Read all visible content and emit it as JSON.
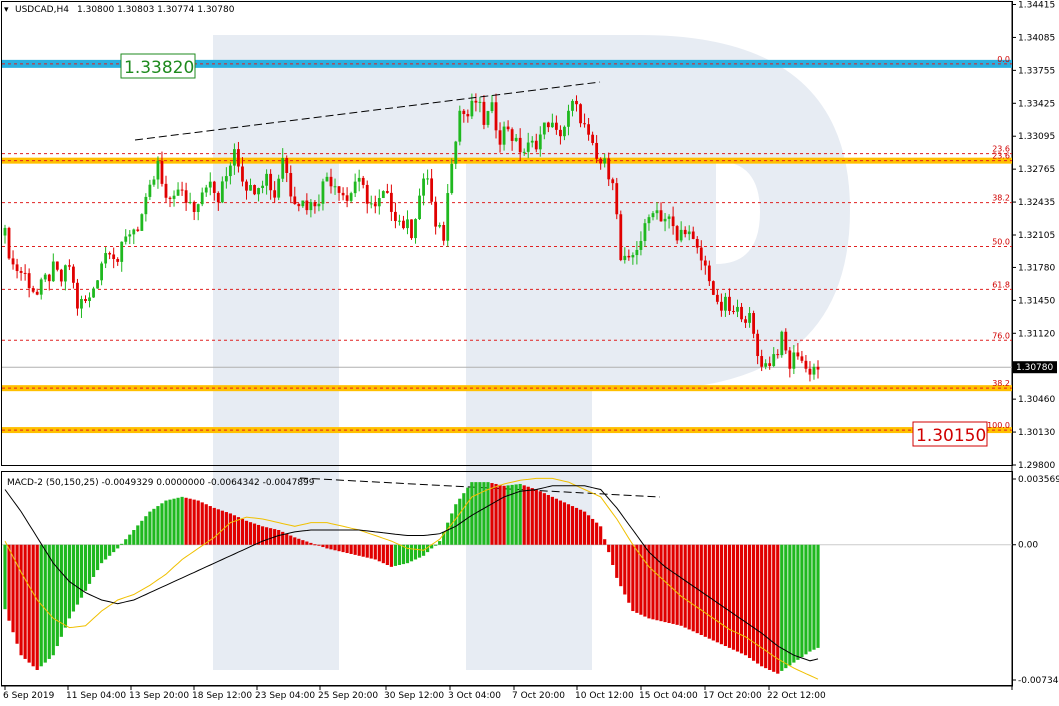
{
  "header": {
    "symbol": "USDCAD,H4",
    "ohlc": "1.30800 1.30803 1.30774 1.30780"
  },
  "macd_header": "MACD-2 (50,150,25) -0.0049329 0.0000000 -0.0064342 -0.0047899",
  "colors": {
    "bull": "#1fb81f",
    "bear": "#e00000",
    "resistance": "#2ab0e0",
    "support": "#ffc000",
    "fib": "#e02020",
    "macd_signal": "#f0c000",
    "macd_line": "#000000"
  },
  "chart_data": {
    "type": "candlestick",
    "symbol": "USDCAD",
    "timeframe": "H4",
    "ylim": [
      1.298,
      1.3441
    ],
    "price_ticks": [
      "1.34415",
      "1.34085",
      "1.33755",
      "1.33425",
      "1.33095",
      "1.32765",
      "1.32435",
      "1.32105",
      "1.31780",
      "1.31450",
      "1.31120",
      "1.30790",
      "1.30460",
      "1.30130",
      "1.29800"
    ],
    "current_price": "1.30780",
    "key_levels": [
      {
        "label": "1.33820",
        "value": 1.3382,
        "kind": "resistance"
      },
      {
        "label": "1.30150",
        "value": 1.3015,
        "kind": "support"
      }
    ],
    "support_zones": [
      1.3285,
      1.3057,
      1.3015
    ],
    "fib_levels": [
      {
        "label": "0.0",
        "value": 1.3382
      },
      {
        "label": "23.6",
        "value": 1.3292
      },
      {
        "label": "23.6",
        "value": 1.3285
      },
      {
        "label": "38.2",
        "value": 1.3243
      },
      {
        "label": "50.0",
        "value": 1.3199
      },
      {
        "label": "61.8",
        "value": 1.3156
      },
      {
        "label": "76.0",
        "value": 1.3105
      },
      {
        "label": "38.2",
        "value": 1.3057
      },
      {
        "label": "100.0",
        "value": 1.3015
      }
    ],
    "x_labels": [
      "6 Sep 2019",
      "11 Sep 04:00",
      "13 Sep 20:00",
      "18 Sep 12:00",
      "23 Sep 04:00",
      "25 Sep 20:00",
      "30 Sep 12:00",
      "3 Oct 04:00",
      "7 Oct 20:00",
      "10 Oct 12:00",
      "15 Oct 04:00",
      "17 Oct 20:00",
      "22 Oct 12:00"
    ],
    "price_anchors": [
      [
        0,
        1.321
      ],
      [
        2,
        1.318
      ],
      [
        5,
        1.317
      ],
      [
        8,
        1.315
      ],
      [
        10,
        1.3165
      ],
      [
        12,
        1.3175
      ],
      [
        14,
        1.3165
      ],
      [
        16,
        1.318
      ],
      [
        18,
        1.314
      ],
      [
        21,
        1.3145
      ],
      [
        24,
        1.3185
      ],
      [
        26,
        1.32
      ],
      [
        28,
        1.3185
      ],
      [
        31,
        1.3215
      ],
      [
        33,
        1.322
      ],
      [
        35,
        1.324
      ],
      [
        38,
        1.328
      ],
      [
        40,
        1.324
      ],
      [
        42,
        1.3255
      ],
      [
        44,
        1.325
      ],
      [
        47,
        1.324
      ],
      [
        50,
        1.3265
      ],
      [
        53,
        1.3245
      ],
      [
        55,
        1.327
      ],
      [
        57,
        1.33
      ],
      [
        59,
        1.327
      ],
      [
        61,
        1.3255
      ],
      [
        63,
        1.3265
      ],
      [
        65,
        1.327
      ],
      [
        67,
        1.325
      ],
      [
        69,
        1.329
      ],
      [
        71,
        1.3255
      ],
      [
        73,
        1.3245
      ],
      [
        76,
        1.324
      ],
      [
        78,
        1.325
      ],
      [
        80,
        1.327
      ],
      [
        83,
        1.326
      ],
      [
        85,
        1.3245
      ],
      [
        87,
        1.3265
      ],
      [
        89,
        1.3255
      ],
      [
        92,
        1.3235
      ],
      [
        94,
        1.325
      ],
      [
        96,
        1.324
      ],
      [
        98,
        1.3225
      ],
      [
        101,
        1.3215
      ],
      [
        103,
        1.325
      ],
      [
        105,
        1.327
      ],
      [
        107,
        1.3215
      ],
      [
        109,
        1.321
      ],
      [
        111,
        1.329
      ],
      [
        113,
        1.3335
      ],
      [
        115,
        1.333
      ],
      [
        117,
        1.3345
      ],
      [
        119,
        1.3325
      ],
      [
        121,
        1.3335
      ],
      [
        123,
        1.331
      ],
      [
        125,
        1.332
      ],
      [
        127,
        1.33
      ],
      [
        129,
        1.3295
      ],
      [
        131,
        1.33
      ],
      [
        133,
        1.331
      ],
      [
        135,
        1.3325
      ],
      [
        137,
        1.331
      ],
      [
        139,
        1.332
      ],
      [
        141,
        1.334
      ],
      [
        143,
        1.333
      ],
      [
        145,
        1.3305
      ],
      [
        147,
        1.3285
      ],
      [
        149,
        1.328
      ],
      [
        151,
        1.327
      ],
      [
        153,
        1.3185
      ],
      [
        155,
        1.318
      ],
      [
        157,
        1.32
      ],
      [
        159,
        1.3215
      ],
      [
        161,
        1.324
      ],
      [
        163,
        1.323
      ],
      [
        165,
        1.3225
      ],
      [
        167,
        1.3205
      ],
      [
        169,
        1.322
      ],
      [
        171,
        1.32
      ],
      [
        173,
        1.3185
      ],
      [
        175,
        1.317
      ],
      [
        177,
        1.3135
      ],
      [
        179,
        1.314
      ],
      [
        181,
        1.313
      ],
      [
        183,
        1.3135
      ],
      [
        185,
        1.3125
      ],
      [
        187,
        1.309
      ],
      [
        189,
        1.308
      ],
      [
        191,
        1.309
      ],
      [
        193,
        1.3105
      ],
      [
        195,
        1.308
      ],
      [
        197,
        1.3095
      ],
      [
        199,
        1.3075
      ],
      [
        201,
        1.3078
      ]
    ],
    "macd": {
      "label": "MACD-2 (50,150,25)",
      "ylim": [
        -0.007344,
        0.0035697
      ],
      "ticks": [
        "0.0035697",
        "0.00",
        "-0.0073440"
      ],
      "hist_anchors": [
        [
          0,
          -0.0035
        ],
        [
          4,
          -0.006
        ],
        [
          8,
          -0.0068
        ],
        [
          12,
          -0.006
        ],
        [
          16,
          -0.004
        ],
        [
          20,
          -0.0025
        ],
        [
          24,
          -0.001
        ],
        [
          28,
          -0.0002
        ],
        [
          32,
          0.0008
        ],
        [
          36,
          0.0018
        ],
        [
          40,
          0.0024
        ],
        [
          44,
          0.0026
        ],
        [
          48,
          0.0024
        ],
        [
          52,
          0.002
        ],
        [
          56,
          0.0017
        ],
        [
          60,
          0.0013
        ],
        [
          64,
          0.001
        ],
        [
          68,
          0.0008
        ],
        [
          72,
          0.0004
        ],
        [
          76,
          0.0001
        ],
        [
          80,
          -0.0002
        ],
        [
          84,
          -0.0004
        ],
        [
          88,
          -0.0006
        ],
        [
          92,
          -0.0008
        ],
        [
          96,
          -0.0012
        ],
        [
          100,
          -0.001
        ],
        [
          104,
          -0.0006
        ],
        [
          108,
          0.0002
        ],
        [
          112,
          0.0022
        ],
        [
          116,
          0.0034
        ],
        [
          120,
          0.0034
        ],
        [
          124,
          0.0032
        ],
        [
          128,
          0.0033
        ],
        [
          132,
          0.003
        ],
        [
          136,
          0.0026
        ],
        [
          140,
          0.0022
        ],
        [
          144,
          0.0018
        ],
        [
          148,
          0.001
        ],
        [
          152,
          -0.0018
        ],
        [
          156,
          -0.0036
        ],
        [
          160,
          -0.004
        ],
        [
          164,
          -0.0042
        ],
        [
          168,
          -0.0044
        ],
        [
          172,
          -0.0048
        ],
        [
          176,
          -0.0052
        ],
        [
          180,
          -0.0056
        ],
        [
          184,
          -0.006
        ],
        [
          188,
          -0.0066
        ],
        [
          192,
          -0.007
        ],
        [
          196,
          -0.0064
        ],
        [
          200,
          -0.0058
        ],
        [
          202,
          -0.0056
        ]
      ],
      "signal_anchors": [
        [
          0,
          0.0002
        ],
        [
          4,
          -0.0015
        ],
        [
          8,
          -0.003
        ],
        [
          12,
          -0.004
        ],
        [
          16,
          -0.0045
        ],
        [
          20,
          -0.0044
        ],
        [
          24,
          -0.0036
        ],
        [
          28,
          -0.003
        ],
        [
          32,
          -0.0027
        ],
        [
          36,
          -0.0022
        ],
        [
          40,
          -0.0016
        ],
        [
          44,
          -0.0008
        ],
        [
          48,
          -0.0002
        ],
        [
          52,
          0.0004
        ],
        [
          56,
          0.0012
        ],
        [
          60,
          0.0015
        ],
        [
          64,
          0.0014
        ],
        [
          68,
          0.0012
        ],
        [
          72,
          0.001
        ],
        [
          76,
          0.0012
        ],
        [
          80,
          0.0012
        ],
        [
          84,
          0.001
        ],
        [
          88,
          0.0008
        ],
        [
          92,
          0.0005
        ],
        [
          96,
          0.0002
        ],
        [
          100,
          -0.0002
        ],
        [
          104,
          -0.0003
        ],
        [
          108,
          0.0003
        ],
        [
          112,
          0.0014
        ],
        [
          116,
          0.0026
        ],
        [
          120,
          0.003
        ],
        [
          124,
          0.0033
        ],
        [
          128,
          0.0035
        ],
        [
          132,
          0.0036
        ],
        [
          136,
          0.0036
        ],
        [
          140,
          0.0034
        ],
        [
          144,
          0.003
        ],
        [
          148,
          0.0026
        ],
        [
          152,
          0.0014
        ],
        [
          156,
          0.0
        ],
        [
          160,
          -0.0012
        ],
        [
          164,
          -0.002
        ],
        [
          168,
          -0.0028
        ],
        [
          172,
          -0.0034
        ],
        [
          176,
          -0.004
        ],
        [
          180,
          -0.0046
        ],
        [
          184,
          -0.005
        ],
        [
          188,
          -0.0056
        ],
        [
          192,
          -0.0062
        ],
        [
          196,
          -0.0067
        ],
        [
          200,
          -0.0071
        ],
        [
          202,
          -0.0073
        ]
      ],
      "line_anchors": [
        [
          0,
          0.003
        ],
        [
          4,
          0.0018
        ],
        [
          8,
          0.0004
        ],
        [
          12,
          -0.001
        ],
        [
          16,
          -0.002
        ],
        [
          20,
          -0.0026
        ],
        [
          24,
          -0.003
        ],
        [
          28,
          -0.0032
        ],
        [
          32,
          -0.003
        ],
        [
          36,
          -0.0026
        ],
        [
          40,
          -0.0022
        ],
        [
          44,
          -0.0018
        ],
        [
          48,
          -0.0014
        ],
        [
          52,
          -0.001
        ],
        [
          56,
          -0.0006
        ],
        [
          60,
          -0.0002
        ],
        [
          64,
          0.0002
        ],
        [
          68,
          0.0005
        ],
        [
          72,
          0.0007
        ],
        [
          76,
          0.0008
        ],
        [
          80,
          0.0008
        ],
        [
          84,
          0.0008
        ],
        [
          88,
          0.0008
        ],
        [
          92,
          0.0007
        ],
        [
          96,
          0.0006
        ],
        [
          100,
          0.0005
        ],
        [
          104,
          0.0005
        ],
        [
          108,
          0.0006
        ],
        [
          112,
          0.001
        ],
        [
          116,
          0.0016
        ],
        [
          120,
          0.0021
        ],
        [
          124,
          0.0026
        ],
        [
          128,
          0.0029
        ],
        [
          132,
          0.003
        ],
        [
          136,
          0.0032
        ],
        [
          140,
          0.0032
        ],
        [
          144,
          0.0032
        ],
        [
          148,
          0.003
        ],
        [
          152,
          0.002
        ],
        [
          156,
          0.0008
        ],
        [
          160,
          -0.0004
        ],
        [
          164,
          -0.0012
        ],
        [
          168,
          -0.0018
        ],
        [
          172,
          -0.0024
        ],
        [
          176,
          -0.003
        ],
        [
          180,
          -0.0036
        ],
        [
          184,
          -0.0042
        ],
        [
          188,
          -0.0048
        ],
        [
          192,
          -0.0055
        ],
        [
          196,
          -0.006
        ],
        [
          200,
          -0.0063
        ],
        [
          202,
          -0.0062
        ]
      ]
    }
  }
}
